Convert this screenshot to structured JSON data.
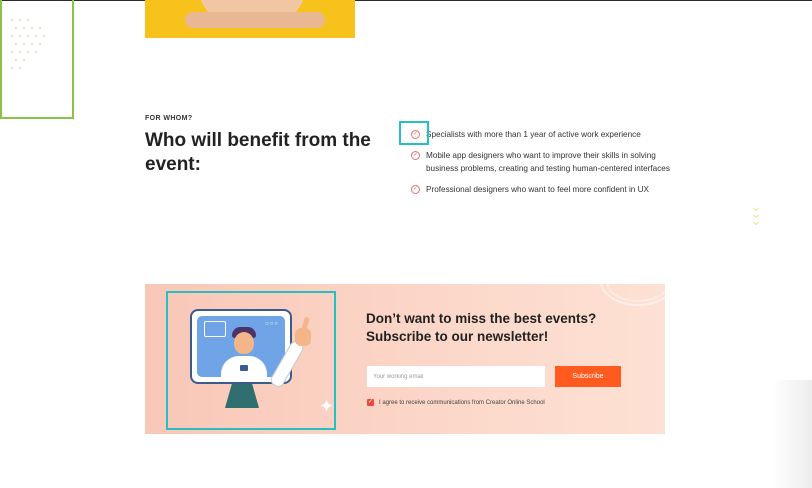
{
  "for_whom": {
    "eyebrow": "FOR WHOM?",
    "heading": "Who will benefit from the event:",
    "benefits": [
      "Specialists with more than 1 year of active work experience",
      "Mobile app designers who want to improve their skills in solving business problems, creating and testing human-centered interfaces",
      "Professional designers who want to feel more confident in UX"
    ]
  },
  "newsletter": {
    "title": "Don’t want to miss the best events? Subscribe to our newsletter!",
    "email_placeholder": "Your working email",
    "email_value": "",
    "subscribe_label": "Subscribe",
    "consent_label": "I agree to receive communications from Creator Online School",
    "consent_checked": true
  },
  "icons": {
    "check": "check-circle-icon",
    "chevron": "chevron-down-icon",
    "checkbox": "checkbox-checked-icon"
  },
  "colors": {
    "accent": "#ff5a1f",
    "check": "#e57373",
    "highlight": "#26bfc4",
    "newsletter_bg": "#f8c7b7",
    "hero_bg": "#f7c21c",
    "corner_border": "#8bc34a"
  }
}
